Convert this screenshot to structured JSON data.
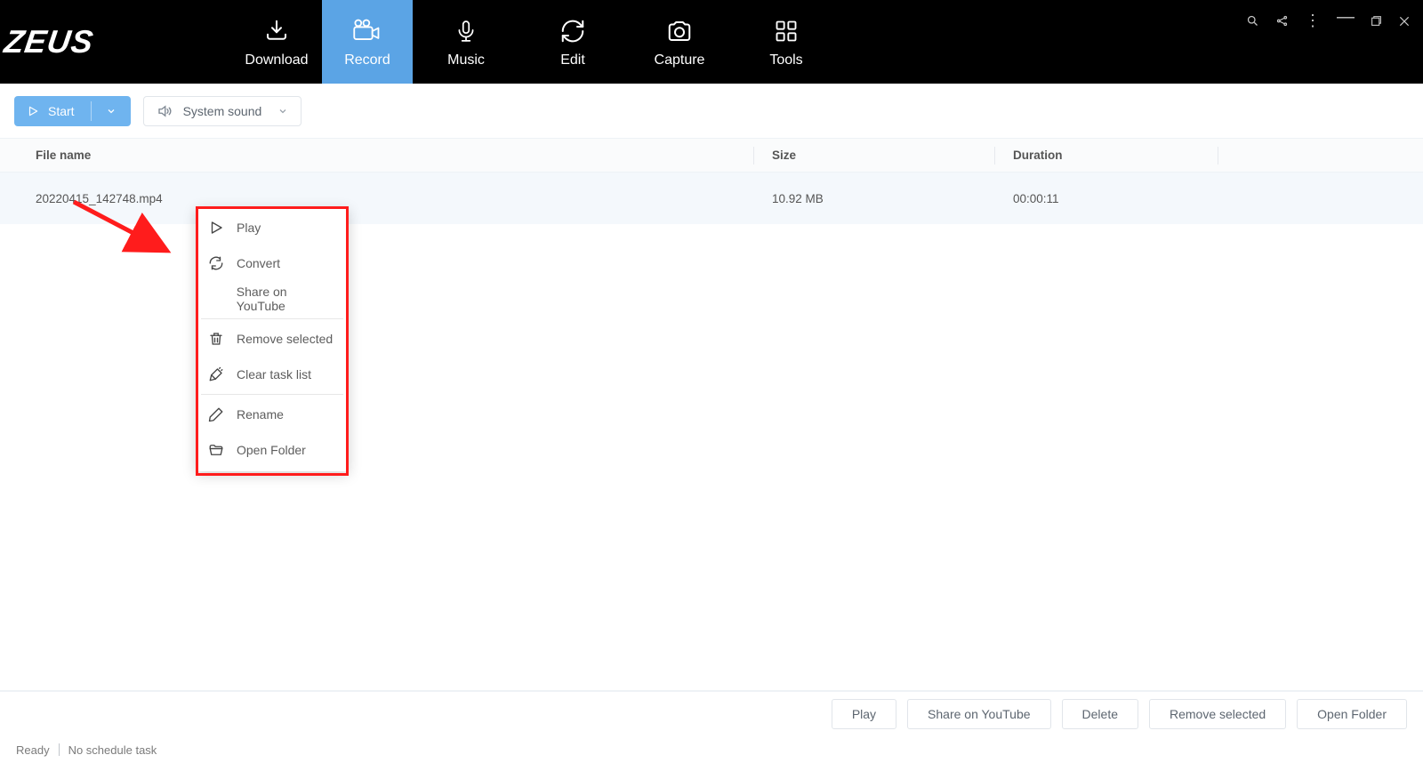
{
  "app": {
    "name": "ZEUS"
  },
  "nav": {
    "download": "Download",
    "record": "Record",
    "music": "Music",
    "edit": "Edit",
    "capture": "Capture",
    "tools": "Tools"
  },
  "toolbar": {
    "start_label": "Start",
    "sound_label": "System sound"
  },
  "table": {
    "headers": {
      "filename": "File name",
      "size": "Size",
      "duration": "Duration"
    },
    "rows": [
      {
        "filename": "20220415_142748.mp4",
        "size": "10.92 MB",
        "duration": "00:00:11"
      }
    ]
  },
  "context_menu": {
    "play": "Play",
    "convert": "Convert",
    "share_youtube": "Share on YouTube",
    "remove_selected": "Remove selected",
    "clear_task_list": "Clear task list",
    "rename": "Rename",
    "open_folder": "Open Folder"
  },
  "footer_buttons": {
    "play": "Play",
    "share_youtube": "Share on YouTube",
    "delete": "Delete",
    "remove_selected": "Remove selected",
    "open_folder": "Open Folder"
  },
  "status": {
    "ready": "Ready",
    "schedule": "No schedule task"
  }
}
